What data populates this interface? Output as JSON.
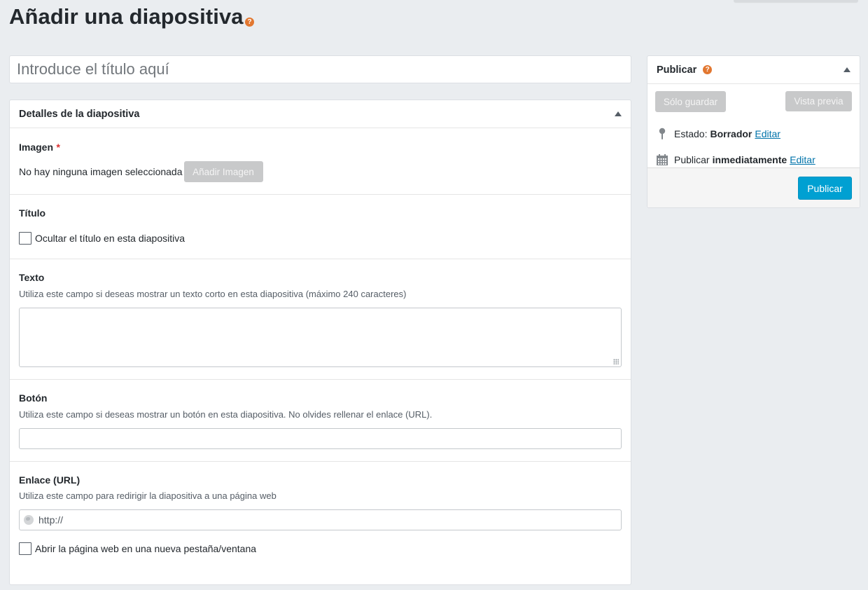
{
  "page": {
    "title": "Añadir una diapositiva",
    "help_icon": "question-circle-icon"
  },
  "title_field": {
    "placeholder": "Introduce el título aquí",
    "value": ""
  },
  "details": {
    "header": "Detalles de la diapositiva",
    "image": {
      "label": "Imagen",
      "required_mark": "*",
      "status_text": "No hay ninguna imagen seleccionada",
      "add_button": "Añadir Imagen"
    },
    "title_section": {
      "label": "Título",
      "hide_checkbox_label": "Ocultar el título en esta diapositiva",
      "hide_checked": false
    },
    "text_section": {
      "label": "Texto",
      "description": "Utiliza este campo si deseas mostrar un texto corto en esta diapositiva (máximo 240 caracteres)",
      "value": ""
    },
    "button_section": {
      "label": "Botón",
      "description": "Utiliza este campo si deseas mostrar un botón en esta diapositiva. No olvides rellenar el enlace (URL).",
      "value": ""
    },
    "link_section": {
      "label": "Enlace (URL)",
      "description": "Utiliza este campo para redirigir la diapositiva a una página web",
      "placeholder": "http://",
      "new_tab_label": "Abrir la página web en una nueva pestaña/ventana",
      "new_tab_checked": false
    }
  },
  "publish": {
    "header": "Publicar",
    "save_button": "Sólo guardar",
    "preview_button": "Vista previa",
    "status_label": "Estado:",
    "status_value": "Borrador",
    "status_edit": "Editar",
    "schedule_label": "Publicar",
    "schedule_value": "inmediatamente",
    "schedule_edit": "Editar",
    "publish_button": "Publicar"
  },
  "colors": {
    "background": "#eaedf0",
    "primary": "#00a0d2",
    "link": "#0073aa",
    "help_icon": "#e27730",
    "required": "#dc3232",
    "disabled_button": "#c8c9ca"
  }
}
